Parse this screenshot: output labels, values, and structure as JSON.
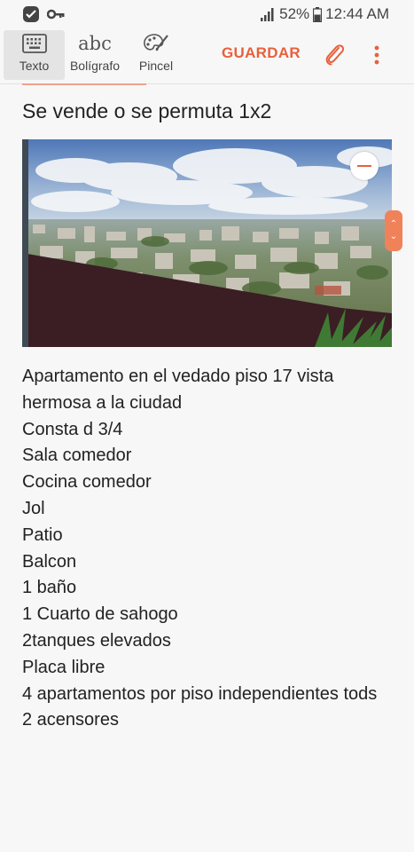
{
  "status_bar": {
    "battery": "52%",
    "time": "12:44 AM"
  },
  "toolbar": {
    "tools": [
      {
        "label": "Texto",
        "icon": "keyboard-icon"
      },
      {
        "label": "Bolígrafo",
        "glyph": "abc",
        "icon": "handwriting-icon"
      },
      {
        "label": "Pincel",
        "icon": "brush-palette-icon"
      }
    ],
    "save_label": "GUARDAR",
    "attach_icon": "paperclip-icon",
    "more_icon": "more-vert-icon"
  },
  "colors": {
    "accent": "#e8603c",
    "handle": "#f0825a"
  },
  "note": {
    "title": "Se vende o se permuta 1x2",
    "lines": [
      "Apartamento en el vedado piso 17 vista hermosa a la ciudad",
      "Consta d 3/4",
      "Sala comedor",
      "Cocina comedor",
      "Jol",
      "Patio",
      "Balcon",
      "1 baño",
      "1 Cuarto de sahogo",
      "2tanques elevados",
      "Placa libre",
      "4 apartamentos por piso independientes tods",
      "2 acensores"
    ]
  }
}
